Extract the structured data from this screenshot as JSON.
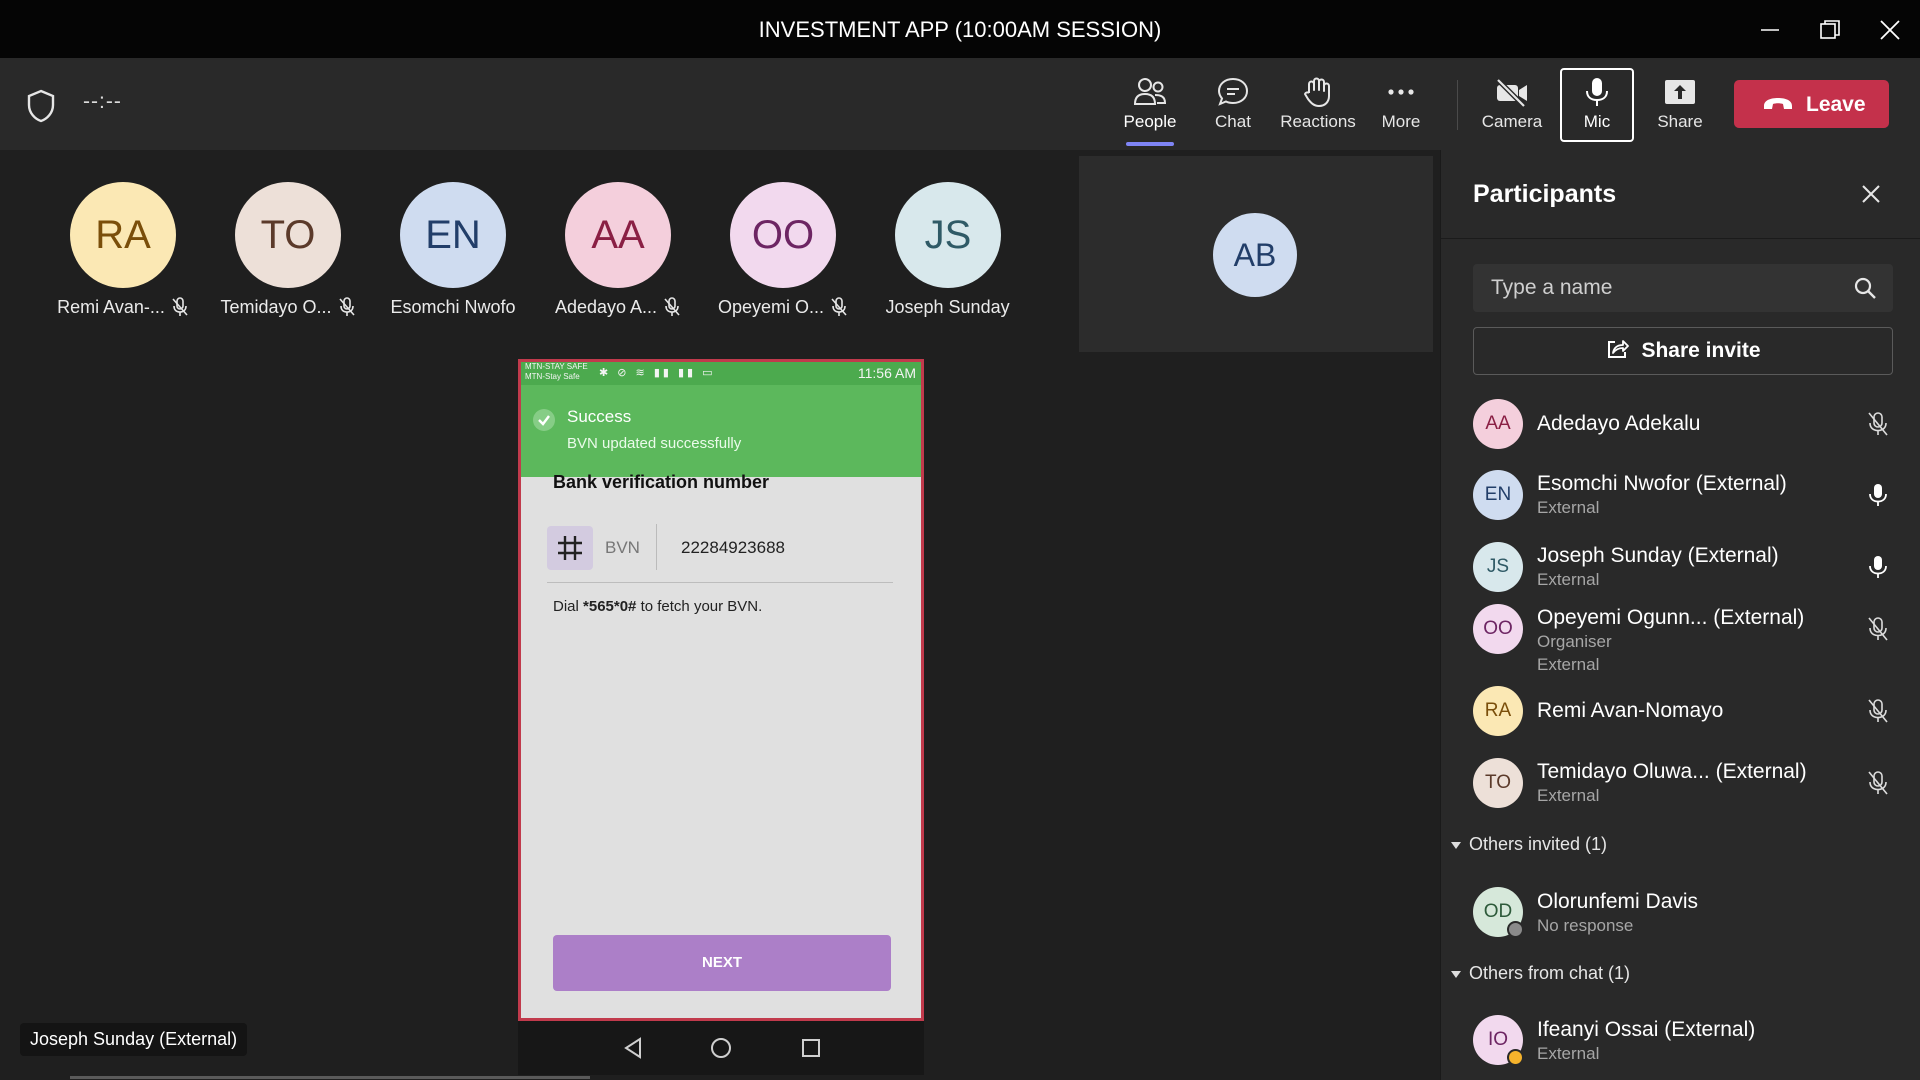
{
  "window": {
    "title": "INVESTMENT APP (10:00AM SESSION)"
  },
  "toolbar": {
    "timer": "--:--",
    "people_label": "People",
    "chat_label": "Chat",
    "reactions_label": "Reactions",
    "more_label": "More",
    "camera_label": "Camera",
    "mic_label": "Mic",
    "share_label": "Share",
    "leave_label": "Leave"
  },
  "strip": [
    {
      "initials": "RA",
      "name": "Remi Avan-...",
      "muted": true,
      "bg": "#fbe8b4",
      "fg": "#7a4e0a"
    },
    {
      "initials": "TO",
      "name": "Temidayo O...",
      "muted": true,
      "bg": "#ede0d8",
      "fg": "#5b3a2a"
    },
    {
      "initials": "EN",
      "name": "Esomchi Nwofo...",
      "muted": false,
      "bg": "#cfdcf0",
      "fg": "#223e69"
    },
    {
      "initials": "AA",
      "name": "Adedayo A...",
      "muted": true,
      "bg": "#f4cfdc",
      "fg": "#8a1f44"
    },
    {
      "initials": "OO",
      "name": "Opeyemi O...",
      "muted": true,
      "bg": "#f2d9ee",
      "fg": "#6d2563"
    },
    {
      "initials": "JS",
      "name": "Joseph Sunday ...",
      "muted": false,
      "bg": "#d8e8ec",
      "fg": "#2f5a66"
    }
  ],
  "self_tile": {
    "initials": "AB"
  },
  "phone": {
    "carrier_line1": "MTN-STAY SAFE",
    "carrier_line2": "MTN-Stay Safe",
    "status_icons": "✱ ⊘ ≋ ▮▮ ▮▮ ▭",
    "time": "11:56 AM",
    "toast_title": "Success",
    "toast_message": "BVN updated successfully",
    "heading": "Bank verification number",
    "field_prefix": "BVN",
    "field_value": "22284923688",
    "hint_prefix": "Dial ",
    "hint_code": "*565*0#",
    "hint_suffix": " to fetch your BVN.",
    "next_label": "NEXT"
  },
  "speaker_tag": "Joseph Sunday (External)",
  "panel": {
    "title": "Participants",
    "search_placeholder": "Type a name",
    "share_invite_label": "Share invite",
    "participants": [
      {
        "initials": "AA",
        "name": "Adedayo Adekalu",
        "subtitles": [],
        "mic": "muted",
        "bg": "#f4cfdc",
        "fg": "#8a1f44"
      },
      {
        "initials": "EN",
        "name": "Esomchi Nwofor (External)",
        "subtitles": [
          "External"
        ],
        "mic": "on",
        "bg": "#cfdcf0",
        "fg": "#223e69"
      },
      {
        "initials": "JS",
        "name": "Joseph Sunday (External)",
        "subtitles": [
          "External"
        ],
        "mic": "on",
        "bg": "#d8e8ec",
        "fg": "#2f5a66"
      },
      {
        "initials": "OO",
        "name": "Opeyemi Ogunn... (External)",
        "subtitles": [
          "Organiser",
          "External"
        ],
        "mic": "muted",
        "bg": "#f2d9ee",
        "fg": "#6d2563"
      },
      {
        "initials": "RA",
        "name": "Remi Avan-Nomayo",
        "subtitles": [],
        "mic": "muted",
        "bg": "#fbe8b4",
        "fg": "#7a4e0a"
      },
      {
        "initials": "TO",
        "name": "Temidayo Oluwa... (External)",
        "subtitles": [
          "External"
        ],
        "mic": "muted",
        "bg": "#ede0d8",
        "fg": "#5b3a2a"
      }
    ],
    "others_invited_header": "Others invited (1)",
    "invited": {
      "initials": "OD",
      "name": "Olorunfemi Davis",
      "subtitle": "No response",
      "bg": "#d6e8da",
      "fg": "#2d5a3a"
    },
    "others_chat_header": "Others from chat (1)",
    "chat_person": {
      "initials": "IO",
      "name": "Ifeanyi Ossai (External)",
      "subtitle": "External",
      "bg": "#f2d9ee",
      "fg": "#6d2563"
    }
  }
}
